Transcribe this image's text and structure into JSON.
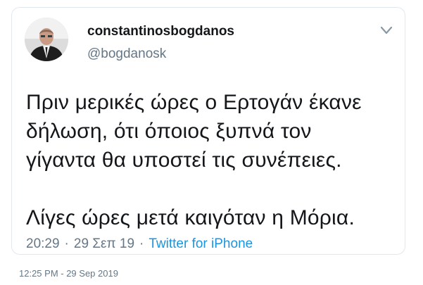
{
  "tweet": {
    "author": {
      "display_name": "constantinosbogdanos",
      "handle": "@bogdanosk"
    },
    "menu_icon": "chevron-down-icon",
    "text": "Πριν μερικές ώρες ο Ερτογάν έκανε\nδήλωση, ότι όποιος ξυπνά τον\nγίγαντα θα υποστεί τις συνέπειες.\n\nΛίγες ώρες μετά καιγόταν η Μόρια.",
    "time": "20:29",
    "date": "29 Σεπ 19",
    "separator": "·",
    "source": "Twitter for iPhone"
  },
  "capture_timestamp": "12:25 PM - 29 Sep 2019",
  "colors": {
    "text": "#14171a",
    "secondary": "#657786",
    "link": "#1b95e0",
    "border": "#e1e8ed"
  }
}
